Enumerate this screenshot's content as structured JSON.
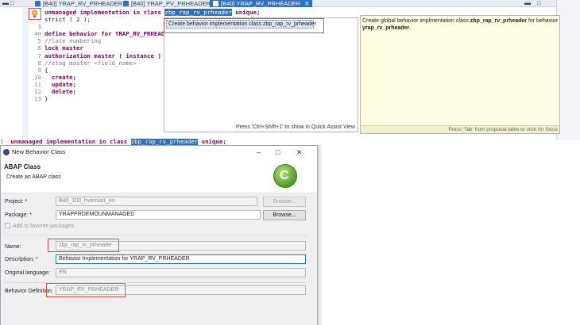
{
  "tabs": [
    {
      "label": "[B40] YRAP_RV_PRHEADER",
      "active": false
    },
    {
      "label": "[B40] YRAP_PV_PRHEADER",
      "active": false
    },
    {
      "label": "[B40] YRAP_RV_PRHEADER",
      "active": true
    }
  ],
  "window_controls": {
    "minimize": "–",
    "maximize": "□",
    "close": "✕"
  },
  "editor": {
    "lines": [
      {
        "num": "",
        "parts": [
          {
            "t": "unmanaged implementation in class ",
            "c": "kw"
          },
          {
            "t": "zbp_rap_rv_prheader",
            "c": "sel"
          },
          {
            "t": " unique;",
            "c": "kw"
          }
        ]
      },
      {
        "num": "",
        "parts": [
          {
            "t": "strict ( 2 );",
            "c": ""
          }
        ]
      },
      {
        "num": "3",
        "parts": []
      },
      {
        "num": "4⊖",
        "parts": [
          {
            "t": "define behavior for YRAP_RV_PRHEADER",
            "c": "kw"
          }
        ]
      },
      {
        "num": "5",
        "parts": [
          {
            "t": "//late numbering",
            "c": "cm"
          }
        ]
      },
      {
        "num": "6",
        "parts": [
          {
            "t": "lock master",
            "c": "kw"
          }
        ]
      },
      {
        "num": "7",
        "parts": [
          {
            "t": "authorization master ( instance )",
            "c": "kw"
          }
        ]
      },
      {
        "num": "8",
        "parts": [
          {
            "t": "//etag master <field_name>",
            "c": "cm"
          }
        ]
      },
      {
        "num": "9",
        "parts": [
          {
            "t": "{",
            "c": ""
          }
        ]
      },
      {
        "num": "10",
        "parts": [
          {
            "t": "  create;",
            "c": "kw"
          }
        ]
      },
      {
        "num": "11",
        "parts": [
          {
            "t": "  update;",
            "c": "kw"
          }
        ]
      },
      {
        "num": "12",
        "parts": [
          {
            "t": "  delete;",
            "c": "kw"
          }
        ]
      },
      {
        "num": "13",
        "parts": [
          {
            "t": "}",
            "c": ""
          }
        ]
      }
    ]
  },
  "quick_assist": {
    "proposal": "Create behavior implementation class zbp_rap_rv_prheader",
    "footer": "Press 'Ctrl+Shift+1' to show in Quick Assist View"
  },
  "doc_popup": {
    "text_prefix": "Create global behavior implmentation class ",
    "class_name": "zbp_rap_rv_prheader",
    "text_mid": " for behavior ",
    "behavior_name": "yrap_rv_prheader",
    "text_end": ".",
    "footer": "Press 'Tab' from proposal table or click for focus"
  },
  "echo_line": {
    "prefix": "1",
    "keyword": "unmanaged implementation in class ",
    "selected": "zbp_rap_rv_prheader",
    "suffix": " unique;"
  },
  "dialog": {
    "title": "New Behavior Class",
    "header_title": "ABAP Class",
    "header_subtitle": "Create an ABAP class",
    "logo_letter": "C",
    "fields": {
      "project_label": "Project: *",
      "project_value": "B40_100_hverma1_en",
      "package_label": "Package: *",
      "package_value": "YRAPPRDEMOUNMANAGED",
      "add_favorites_label": "Add to favorite packages",
      "name_label": "Name:",
      "name_value": "zbp_rap_rv_prheader",
      "description_label": "Description: *",
      "description_value": "Behavior Implementation for YRAP_RV_PRHEADER",
      "orig_lang_label": "Original language:",
      "orig_lang_value": "EN",
      "behavior_def_label": "Behavior Definition:",
      "behavior_def_value": "YRAP_RV_PRHEADER"
    },
    "browse_label": "Browse..."
  },
  "colors": {
    "highlight": "#e04b4b",
    "selection": "#2f6fc0",
    "keyword": "#7f0055",
    "doc_bg": "#fffde1"
  }
}
